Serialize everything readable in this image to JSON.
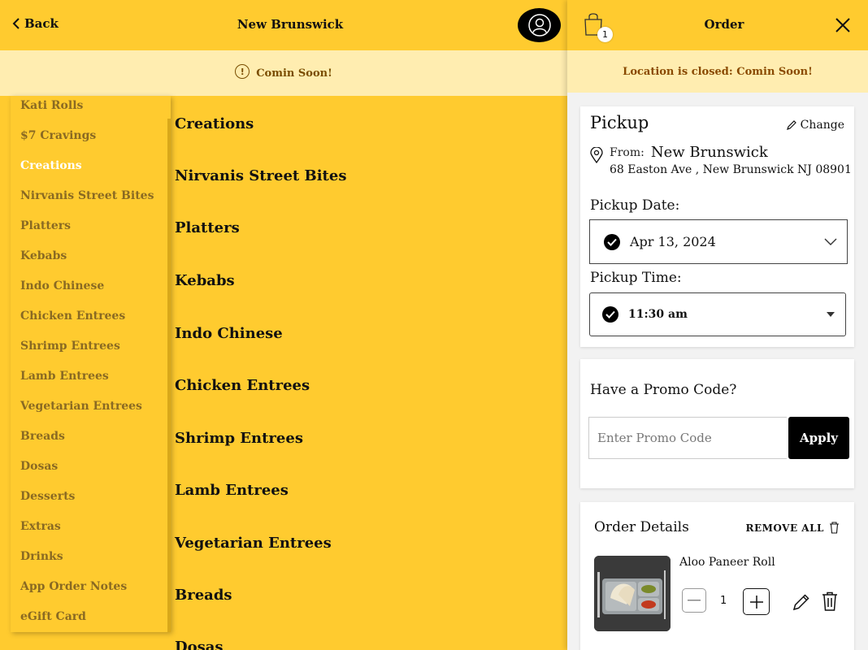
{
  "header": {
    "back_label": "Back",
    "location_title": "New Brunswick",
    "notice": "Comin Soon!"
  },
  "categories": [
    {
      "label": "Kati Rolls",
      "active": false
    },
    {
      "label": "$7 Cravings",
      "active": false
    },
    {
      "label": "Creations",
      "active": true
    },
    {
      "label": "Nirvanis Street Bites",
      "active": false
    },
    {
      "label": "Platters",
      "active": false
    },
    {
      "label": "Kebabs",
      "active": false
    },
    {
      "label": "Indo Chinese",
      "active": false
    },
    {
      "label": "Chicken Entrees",
      "active": false
    },
    {
      "label": "Shrimp Entrees",
      "active": false
    },
    {
      "label": "Lamb Entrees",
      "active": false
    },
    {
      "label": "Vegetarian Entrees",
      "active": false
    },
    {
      "label": "Breads",
      "active": false
    },
    {
      "label": "Dosas",
      "active": false
    },
    {
      "label": "Desserts",
      "active": false
    },
    {
      "label": "Extras",
      "active": false
    },
    {
      "label": "Drinks",
      "active": false
    },
    {
      "label": "App Order Notes",
      "active": false
    },
    {
      "label": "eGift Card",
      "active": false
    }
  ],
  "sections": [
    "Creations",
    "Nirvanis Street Bites",
    "Platters",
    "Kebabs",
    "Indo Chinese",
    "Chicken Entrees",
    "Shrimp Entrees",
    "Lamb Entrees",
    "Vegetarian Entrees",
    "Breads",
    "Dosas"
  ],
  "order": {
    "title": "Order",
    "bag_count": "1",
    "notice": "Location is closed: Comin Soon!",
    "pickup": {
      "title": "Pickup",
      "change_label": "Change",
      "from_label": "From:",
      "location_name": "New Brunswick",
      "address": "68 Easton Ave , New Brunswick NJ 08901",
      "date_label": "Pickup Date:",
      "date_value": "Apr 13, 2024",
      "time_label": "Pickup Time:",
      "time_value": "11:30 am"
    },
    "promo": {
      "question": "Have a Promo Code?",
      "placeholder": "Enter Promo Code",
      "apply_label": "Apply"
    },
    "details": {
      "title": "Order Details",
      "remove_all_label": "REMOVE ALL",
      "items": [
        {
          "name": "Aloo Paneer Roll",
          "quantity": "1"
        }
      ]
    }
  },
  "colors": {
    "brand_yellow": "#FFCB2F",
    "notice_bg": "#FFEDB0",
    "notice_text": "#8a4a00"
  }
}
